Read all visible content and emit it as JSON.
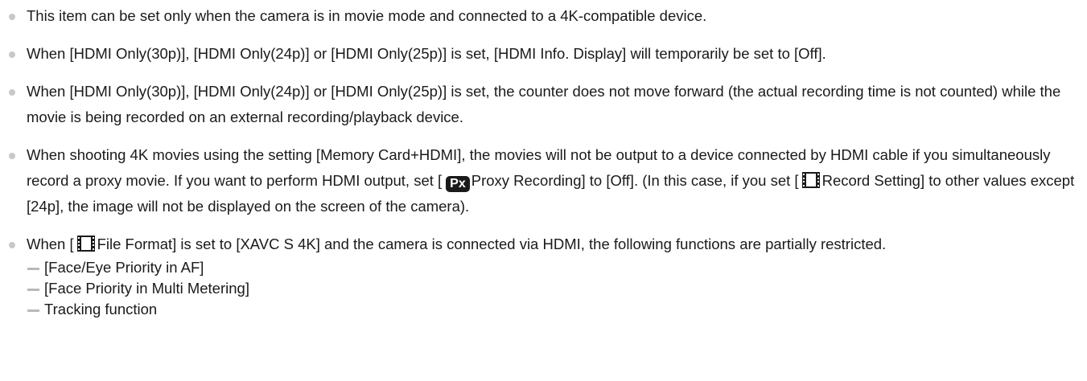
{
  "notes": [
    {
      "text": "This item can be set only when the camera is in movie mode and connected to a 4K-compatible device."
    },
    {
      "text": "When [HDMI Only(30p)], [HDMI Only(24p)] or [HDMI Only(25p)] is set, [HDMI Info. Display] will temporarily be set to [Off]."
    },
    {
      "text": "When [HDMI Only(30p)], [HDMI Only(24p)] or [HDMI Only(25p)] is set, the counter does not move forward (the actual recording time is not counted) while the movie is being recorded on an external recording/playback device."
    },
    {
      "part1": "When shooting 4K movies using the setting [Memory Card+HDMI], the movies will not be output to a device connected by HDMI cable if you simultaneously record a proxy movie. If you want to perform HDMI output, set [",
      "px_icon_label": "Px",
      "part2": "Proxy Recording] to [Off]. (In this case, if you set [",
      "part3": "Record Setting] to other values except [24p], the image will not be displayed on the screen of the camera)."
    },
    {
      "part1": "When [",
      "part2": "File Format] is set to [XAVC S 4K] and the camera is connected via HDMI, the following functions are partially restricted.",
      "sub_items": [
        "[Face/Eye Priority in AF]",
        "[Face Priority in Multi Metering]",
        "Tracking function"
      ]
    }
  ],
  "icons": {
    "bullet": "grey-dot-icon",
    "proxy": "px-icon",
    "movie": "film-strip-icon",
    "dash": "dash-icon"
  },
  "colors": {
    "text": "#1a1a1a",
    "bullet": "#c8c8c8",
    "dash": "#b9b9b9"
  }
}
